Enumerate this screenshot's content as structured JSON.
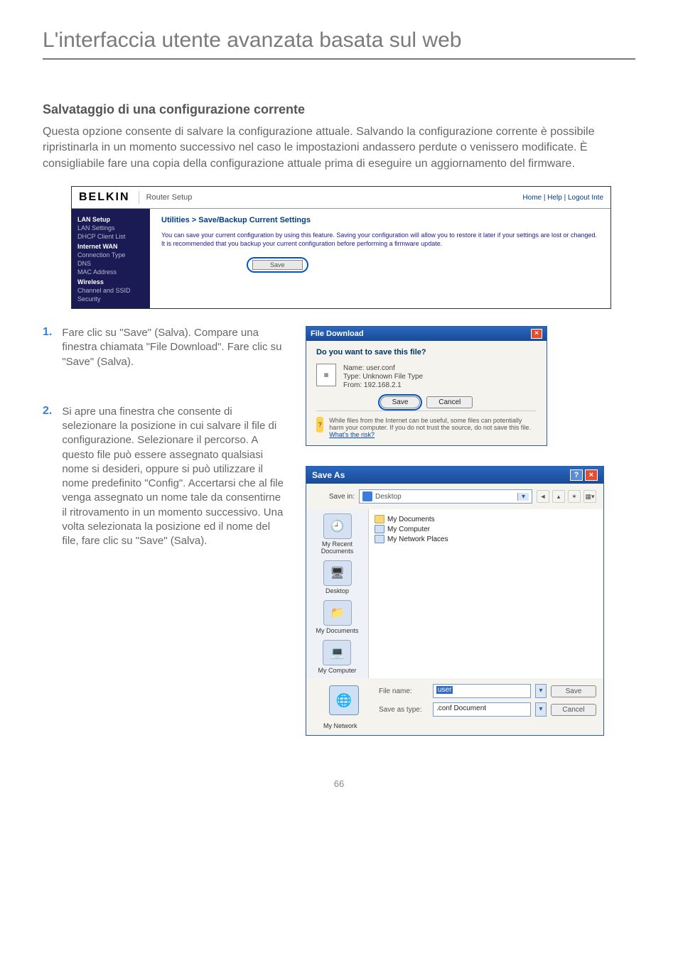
{
  "page": {
    "title": "L'interfaccia utente avanzata basata sul web",
    "section_title": "Salvataggio di una configurazione corrente",
    "intro": "Questa opzione consente di salvare la configurazione attuale. Salvando la configurazione corrente è possibile ripristinarla in un momento successivo nel caso le impostazioni andassero perdute o venissero modificate. È consigliabile fare una copia della configurazione attuale prima di eseguire un aggiornamento del firmware.",
    "page_number": "66"
  },
  "router": {
    "brand": "BELKIN",
    "title": "Router Setup",
    "links": "Home | Help | Logout   Inte",
    "nav": {
      "lan_setup": "LAN Setup",
      "lan_settings": "LAN Settings",
      "dhcp": "DHCP Client List",
      "internet_wan": "Internet WAN",
      "conn_type": "Connection Type",
      "dns": "DNS",
      "mac": "MAC Address",
      "wireless": "Wireless",
      "channel": "Channel and SSID",
      "security": "Security"
    },
    "breadcrumb": "Utilities > Save/Backup Current Settings",
    "desc": "You can save your current configuration by using this feature. Saving your configuration will allow you to restore it later if your settings are lost or changed. It is recommended that you backup your current configuration before performing a firmware update.",
    "save_label": "Save"
  },
  "steps": {
    "one_num": "1.",
    "one_text": "Fare clic su \"Save\" (Salva). Compare una finestra chiamata \"File Download\". Fare clic su \"Save\" (Salva).",
    "two_num": "2.",
    "two_text": "Si apre una finestra che consente di selezionare la posizione in cui salvare il file di configurazione. Selezionare il percorso. A questo file può essere assegnato qualsiasi nome si desideri, oppure si può utilizzare il nome predefinito \"Config\". Accertarsi che al file venga assegnato un nome tale da consentirne il ritrovamento in un momento successivo. Una volta selezionata la posizione ed il nome del file, fare clic su \"Save\" (Salva)."
  },
  "file_download": {
    "title": "File Download",
    "question": "Do you want to save this file?",
    "name_label": "Name:",
    "name_value": "user.conf",
    "type_label": "Type:",
    "type_value": "Unknown File Type",
    "from_label": "From:",
    "from_value": "192.168.2.1",
    "save": "Save",
    "cancel": "Cancel",
    "warn_text": "While files from the Internet can be useful, some files can potentially harm your computer. If you do not trust the source, do not save this file.",
    "warn_link": "What's the risk?"
  },
  "save_as": {
    "title": "Save As",
    "savein_label": "Save in:",
    "savein_value": "Desktop",
    "places": {
      "recent": "My Recent Documents",
      "desktop": "Desktop",
      "mydocs": "My Documents",
      "mycomp": "My Computer",
      "mynet": "My Network"
    },
    "files": {
      "mydocuments": "My Documents",
      "mycomputer": "My Computer",
      "mynetworkplaces": "My Network Places"
    },
    "filename_label": "File name:",
    "filename_value": "user",
    "saveastype_label": "Save as type:",
    "saveastype_value": ".conf Document",
    "save": "Save",
    "cancel": "Cancel"
  }
}
